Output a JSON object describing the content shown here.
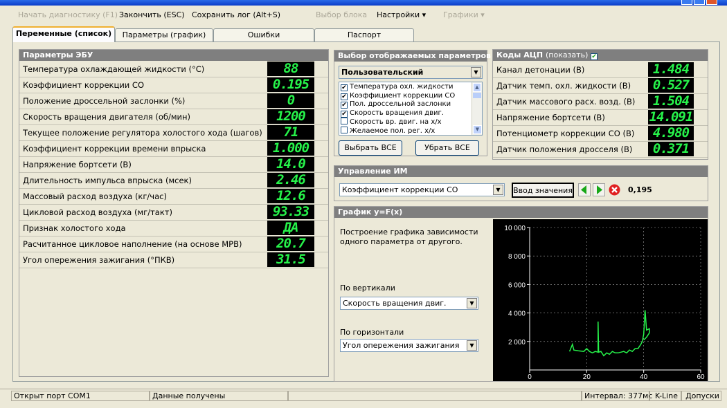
{
  "menu": {
    "start_diag": "Начать диагностику (F1)",
    "finish": "Закончить (ESC)",
    "save_log": "Сохранить лог (Alt+S)",
    "select_block": "Выбор блока",
    "settings": "Настройки ▾",
    "charts": "Графики ▾"
  },
  "tabs": [
    "Переменные (список)",
    "Параметры (график)",
    "Ошибки",
    "Паспорт"
  ],
  "ecu": {
    "title": "Параметры ЭБУ",
    "rows": [
      {
        "label": "Температура охлаждающей жидкости (°С)",
        "value": "88"
      },
      {
        "label": "Коэффициент коррекции СО",
        "value": "0.195"
      },
      {
        "label": "Положение дроссельной заслонки (%)",
        "value": "0"
      },
      {
        "label": "Скорость вращения двигателя (об/мин)",
        "value": "1200"
      },
      {
        "label": "Текущее положение регулятора холостого хода (шагов)",
        "value": "71"
      },
      {
        "label": "Коэффициент коррекции времени впрыска",
        "value": "1.000"
      },
      {
        "label": "Напряжение бортсети (В)",
        "value": "14.0"
      },
      {
        "label": "Длительность импульса впрыска (мсек)",
        "value": "2.46"
      },
      {
        "label": "Массовый расход воздуха (кг/час)",
        "value": "12.6"
      },
      {
        "label": "Цикловой расход воздуха (мг/такт)",
        "value": "93.33"
      },
      {
        "label": "Признак холостого хода",
        "value": "ДА"
      },
      {
        "label": "Расчитанное цикловое наполнение (на основе МРВ)",
        "value": "20.7"
      },
      {
        "label": "Угол опережения зажигания (°ПКВ)",
        "value": "31.5"
      }
    ]
  },
  "params_select": {
    "title": "Выбор отображаемых параметров",
    "preset": "Пользовательский",
    "items": [
      {
        "label": "Температура охл. жидкости",
        "checked": true
      },
      {
        "label": "Коэффициент коррекции СО",
        "checked": true
      },
      {
        "label": "Пол. дроссельной заслонки",
        "checked": true
      },
      {
        "label": "Скорость вращения двиг.",
        "checked": true
      },
      {
        "label": "Скорость вр. двиг. на х/х",
        "checked": false
      },
      {
        "label": "Желаемое пол. рег. х/х",
        "checked": false
      }
    ],
    "select_all": "Выбрать ВСЕ",
    "clear_all": "Убрать ВСЕ",
    "check_mark": "✔"
  },
  "adc": {
    "title": "Коды АЦП",
    "show_link": "(показать)",
    "rows": [
      {
        "label": "Канал детонации (В)",
        "value": "1.484"
      },
      {
        "label": "Датчик темп. охл. жидкости (В)",
        "value": "0.527"
      },
      {
        "label": "Датчик массового расх. возд. (В)",
        "value": "1.504"
      },
      {
        "label": "Напряжение бортсети (В)",
        "value": "14.091"
      },
      {
        "label": "Потенциометр коррекции СО (В)",
        "value": "4.980"
      },
      {
        "label": "Датчик положения дросселя (В)",
        "value": "0.371"
      }
    ]
  },
  "control": {
    "title": "Управление ИМ",
    "selected": "Коэффициент коррекции СО",
    "enter_label": "Ввод значения",
    "value": "0,195"
  },
  "graph": {
    "title": "График y=F(x)",
    "description": "Построение графика зависимости одного параметра от другого.",
    "vertical_label": "По вертикали",
    "vertical_value": "Скорость вращения двиг.",
    "horizontal_label": "По горизонтали",
    "horizontal_value": "Угол опережения зажигания"
  },
  "chart_data": {
    "type": "line",
    "xlabel": "",
    "ylabel": "",
    "xlim": [
      0,
      60
    ],
    "ylim": [
      0,
      10000
    ],
    "x_ticks": [
      "0",
      "20",
      "40",
      "60"
    ],
    "y_ticks": [
      "2 000",
      "4 000",
      "6 000",
      "8 000",
      "10 000"
    ],
    "grid": true,
    "series": [
      {
        "color": "#26f34a",
        "points": [
          [
            14,
            1300
          ],
          [
            15,
            1800
          ],
          [
            15.5,
            1400
          ],
          [
            17,
            1350
          ],
          [
            19,
            1300
          ],
          [
            20,
            1500
          ],
          [
            21,
            1300
          ],
          [
            22,
            1200
          ],
          [
            23,
            1300
          ],
          [
            24,
            1250
          ],
          [
            24,
            3400
          ],
          [
            24.2,
            1250
          ],
          [
            25,
            1300
          ],
          [
            26,
            1000
          ],
          [
            27,
            1200
          ],
          [
            28,
            1100
          ],
          [
            29,
            1300
          ],
          [
            30,
            1200
          ],
          [
            31,
            1200
          ],
          [
            32,
            1250
          ],
          [
            33,
            1300
          ],
          [
            34,
            1200
          ],
          [
            35,
            1400
          ],
          [
            36,
            1300
          ],
          [
            37,
            1500
          ],
          [
            38,
            1500
          ],
          [
            39,
            1800
          ],
          [
            39.5,
            2000
          ],
          [
            40,
            2500
          ],
          [
            40.5,
            4200
          ],
          [
            41,
            2800
          ],
          [
            42,
            2900
          ],
          [
            42,
            2600
          ],
          [
            41,
            2300
          ],
          [
            40,
            2100
          ]
        ]
      }
    ]
  },
  "status": {
    "port": "Открыт порт COM1",
    "data": "Данные получены",
    "interval": "Интервал: 377мс",
    "kline": "K-Line",
    "tolerance": "Допуски"
  }
}
